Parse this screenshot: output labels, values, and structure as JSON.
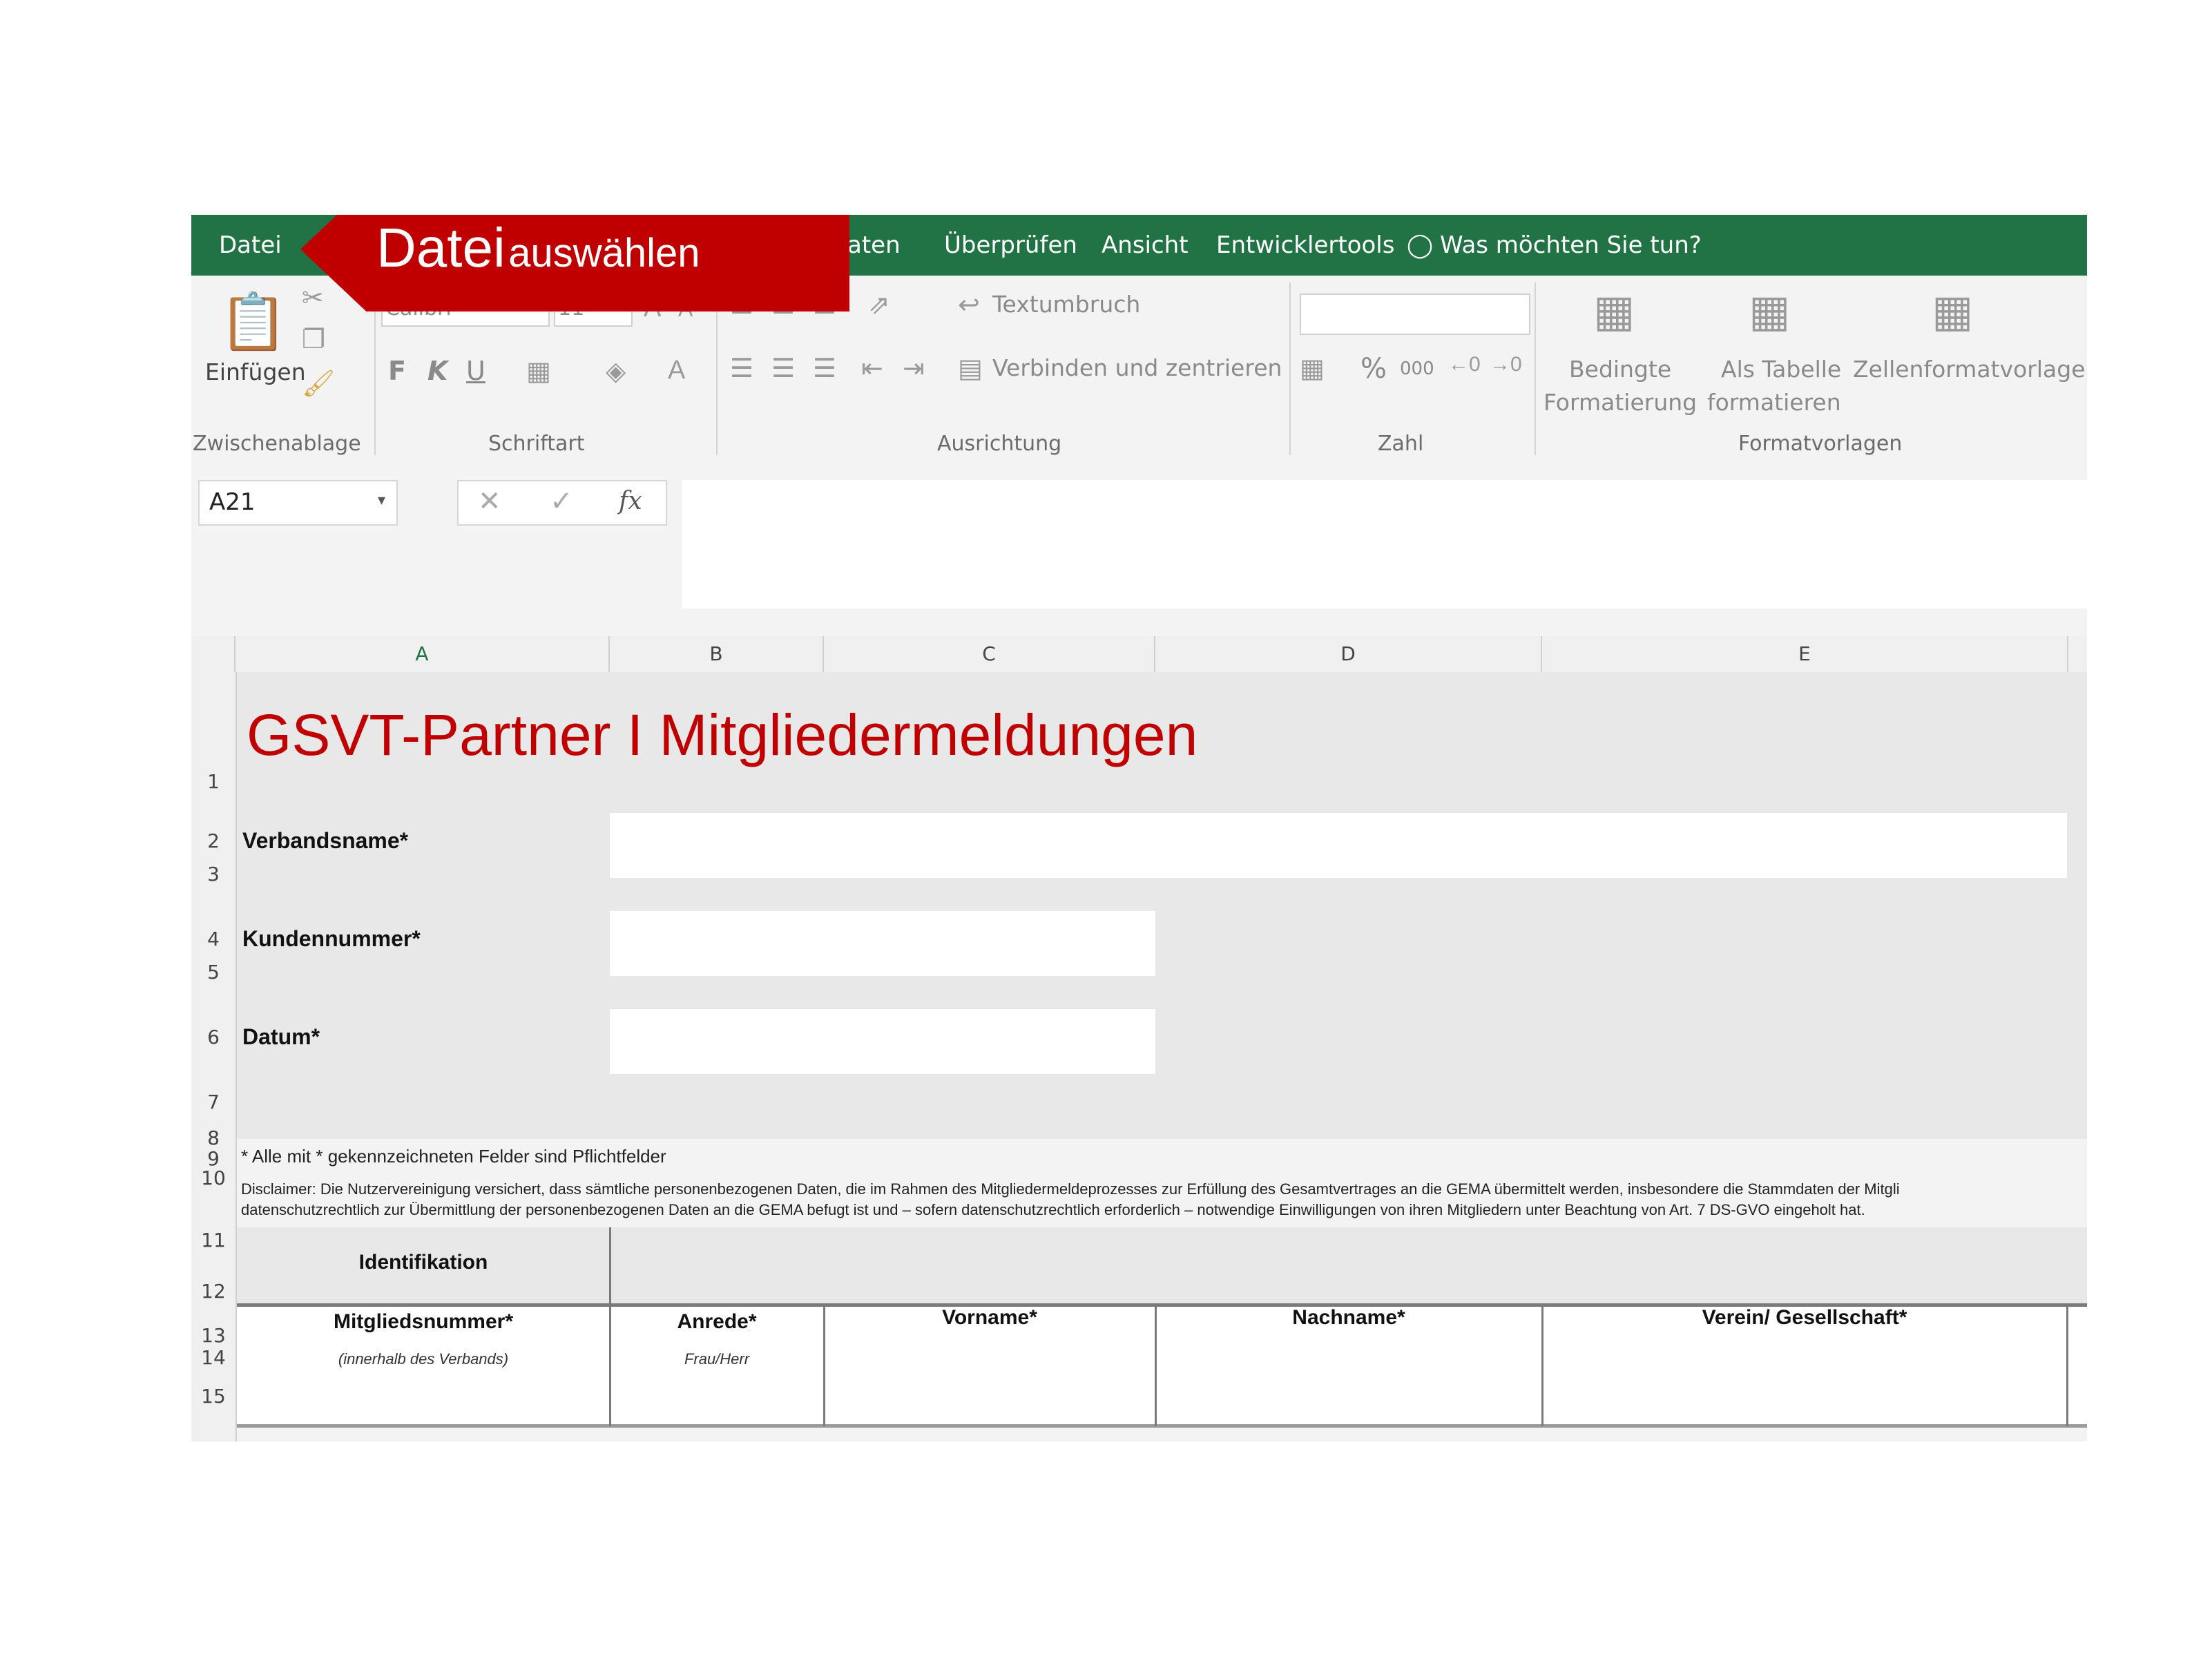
{
  "ribbon_tabs": {
    "file": "Datei",
    "data_partial": "aten",
    "review": "Überprüfen",
    "view": "Ansicht",
    "developer": "Entwicklertools",
    "tell_me": "Was möchten Sie tun?"
  },
  "callout": {
    "big": "Datei",
    "small": "auswählen"
  },
  "clipboard": {
    "paste": "Einfügen",
    "group": "Zwischenablage"
  },
  "font": {
    "name": "Calibri",
    "size": "11",
    "group": "Schriftart",
    "bold": "F",
    "italic": "K",
    "underline": "U"
  },
  "alignment": {
    "wrap": "Textumbruch",
    "merge": "Verbinden und zentrieren",
    "group": "Ausrichtung"
  },
  "number": {
    "group": "Zahl",
    "percent": "%",
    "thousands": "000"
  },
  "styles": {
    "conditional_1": "Bedingte",
    "conditional_2": "Formatierung",
    "table_1": "Als Tabelle",
    "table_2": "formatieren",
    "cellstyles": "Zellenformatvorlagen",
    "group": "Formatvorlagen"
  },
  "formula_bar": {
    "name_box": "A21",
    "fx": "fx"
  },
  "columns": [
    "A",
    "B",
    "C",
    "D",
    "E"
  ],
  "rows": [
    "1",
    "2",
    "3",
    "4",
    "5",
    "6",
    "7",
    "8",
    "9",
    "10",
    "11",
    "12",
    "13",
    "14",
    "15"
  ],
  "sheet": {
    "title": "GSVT-Partner I Mitgliedermeldungen",
    "verbandsname": "Verbandsname*",
    "kundennummer": "Kundennummer*",
    "datum": "Datum*",
    "note": "* Alle mit * gekennzeichneten Felder sind Pflichtfelder",
    "disclaimer_1": "Disclaimer: Die Nutzervereinigung versichert, dass sämtliche personenbezogenen Daten, die im Rahmen des Mitgliedermeldeprozesses zur Erfüllung des Gesamtvertrages an die GEMA übermittelt werden, insbesondere die Stammdaten der Mitgli",
    "disclaimer_2": "datenschutzrechtlich zur Übermittlung der personenbezogenen Daten an die GEMA befugt ist und – sofern datenschutzrechtlich erforderlich – notwendige Einwilligungen von ihren Mitgliedern unter Beachtung von Art. 7 DS-GVO eingeholt hat.",
    "identifikation": "Identifikation",
    "col_mitglied": "Mitgliedsnummer*",
    "col_mitglied_sub": "(innerhalb des Verbands)",
    "col_anrede": "Anrede*",
    "col_anrede_sub": "Frau/Herr",
    "col_vorname": "Vorname*",
    "col_nachname": "Nachname*",
    "col_verein": "Verein/ Gesellschaft*"
  }
}
